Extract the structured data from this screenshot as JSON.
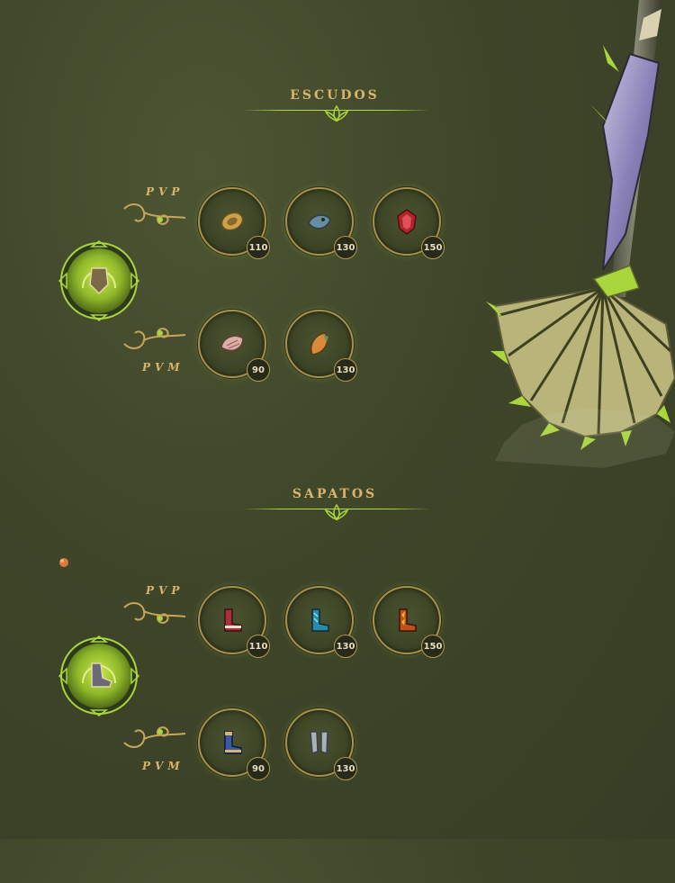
{
  "sections": [
    {
      "title": "ESCUDOS",
      "category_icon": "shield-icon",
      "pvp": {
        "label": "PVP",
        "items": [
          {
            "icon": "golden-shield-icon",
            "level": "110"
          },
          {
            "icon": "blue-fish-shield-icon",
            "level": "130"
          },
          {
            "icon": "red-gem-shield-icon",
            "level": "150"
          }
        ]
      },
      "pvm": {
        "label": "PVM",
        "items": [
          {
            "icon": "pink-shell-shield-icon",
            "level": "90"
          },
          {
            "icon": "orange-leaf-shield-icon",
            "level": "130"
          }
        ]
      }
    },
    {
      "title": "SAPATOS",
      "category_icon": "boot-icon",
      "pvp": {
        "label": "PVP",
        "items": [
          {
            "icon": "red-boots-icon",
            "level": "110"
          },
          {
            "icon": "blue-boots-icon",
            "level": "130"
          },
          {
            "icon": "fire-boots-icon",
            "level": "150"
          }
        ]
      },
      "pvm": {
        "label": "PVM",
        "items": [
          {
            "icon": "gold-blue-boots-icon",
            "level": "90"
          },
          {
            "icon": "silver-boots-icon",
            "level": "130"
          }
        ]
      }
    }
  ],
  "colors": {
    "gold": "#d8b56a",
    "accent_green": "#a8d63c",
    "background": "#3e4529"
  }
}
